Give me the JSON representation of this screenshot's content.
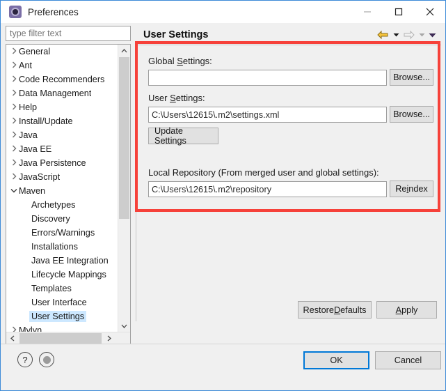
{
  "window": {
    "title": "Preferences",
    "icon": "preferences-gear-icon",
    "controls": {
      "minimize": "minimize-icon",
      "maximize": "maximize-icon",
      "close": "close-icon"
    }
  },
  "sidebar": {
    "filter": {
      "value": "",
      "placeholder": "type filter text"
    },
    "items": [
      {
        "label": "General",
        "level": 0,
        "expander": "collapsed",
        "selected": false
      },
      {
        "label": "Ant",
        "level": 0,
        "expander": "collapsed",
        "selected": false
      },
      {
        "label": "Code Recommenders",
        "level": 0,
        "expander": "collapsed",
        "selected": false
      },
      {
        "label": "Data Management",
        "level": 0,
        "expander": "collapsed",
        "selected": false
      },
      {
        "label": "Help",
        "level": 0,
        "expander": "collapsed",
        "selected": false
      },
      {
        "label": "Install/Update",
        "level": 0,
        "expander": "collapsed",
        "selected": false
      },
      {
        "label": "Java",
        "level": 0,
        "expander": "collapsed",
        "selected": false
      },
      {
        "label": "Java EE",
        "level": 0,
        "expander": "collapsed",
        "selected": false
      },
      {
        "label": "Java Persistence",
        "level": 0,
        "expander": "collapsed",
        "selected": false
      },
      {
        "label": "JavaScript",
        "level": 0,
        "expander": "collapsed",
        "selected": false
      },
      {
        "label": "Maven",
        "level": 0,
        "expander": "expanded",
        "selected": false
      },
      {
        "label": "Archetypes",
        "level": 1,
        "expander": "none",
        "selected": false
      },
      {
        "label": "Discovery",
        "level": 1,
        "expander": "none",
        "selected": false
      },
      {
        "label": "Errors/Warnings",
        "level": 1,
        "expander": "none",
        "selected": false
      },
      {
        "label": "Installations",
        "level": 1,
        "expander": "none",
        "selected": false
      },
      {
        "label": "Java EE Integration",
        "level": 1,
        "expander": "none",
        "selected": false
      },
      {
        "label": "Lifecycle Mappings",
        "level": 1,
        "expander": "none",
        "selected": false
      },
      {
        "label": "Templates",
        "level": 1,
        "expander": "none",
        "selected": false
      },
      {
        "label": "User Interface",
        "level": 1,
        "expander": "none",
        "selected": false
      },
      {
        "label": "User Settings",
        "level": 1,
        "expander": "none",
        "selected": true
      },
      {
        "label": "Mylyn",
        "level": 0,
        "expander": "collapsed",
        "selected": false
      }
    ]
  },
  "header": {
    "title": "User Settings",
    "back_icon": "back-arrow-icon",
    "back_caret_icon": "chevron-down-icon",
    "forward_icon": "forward-arrow-icon",
    "forward_caret_icon": "chevron-down-icon",
    "menu_caret_icon": "chevron-down-icon"
  },
  "form": {
    "global_settings": {
      "label_pre": "Global ",
      "label_key": "S",
      "label_post": "ettings:",
      "value": "",
      "placeholder": "",
      "browse_label": "Browse..."
    },
    "user_settings": {
      "label_pre": "User ",
      "label_key": "S",
      "label_post": "ettings:",
      "value": "C:\\Users\\12615\\.m2\\settings.xml",
      "placeholder": "",
      "browse_label": "Browse..."
    },
    "update_settings_label": "Update Settings",
    "local_repository": {
      "label": "Local Repository (From merged user and global settings):",
      "value": "C:\\Users\\12615\\.m2\\repository",
      "placeholder": "",
      "reindex_pre": "Re",
      "reindex_key": "i",
      "reindex_post": "ndex"
    },
    "restore_defaults": {
      "pre": "Restore ",
      "key": "D",
      "post": "efaults"
    },
    "apply": {
      "pre": "",
      "key": "A",
      "post": "pply"
    }
  },
  "footer": {
    "help_icon": "help-question-icon",
    "secondary_icon": "status-circle-icon",
    "ok_label": "OK",
    "cancel_label": "Cancel"
  },
  "annotation": {
    "shape": "rectangle",
    "color": "#f6413a"
  }
}
